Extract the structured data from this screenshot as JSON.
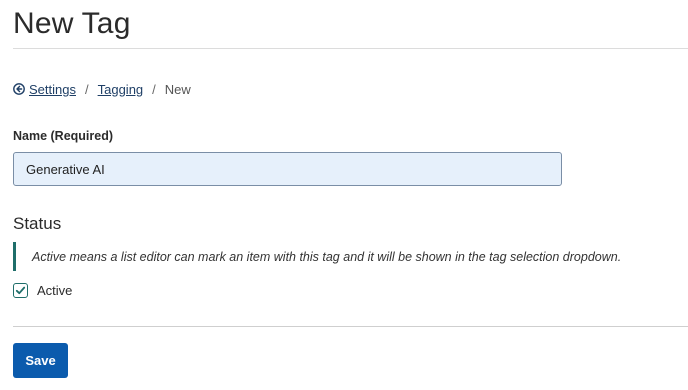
{
  "page": {
    "title": "New Tag"
  },
  "breadcrumb": {
    "back_icon": "circle-arrow-left-icon",
    "items": [
      {
        "label": "Settings",
        "link": true
      },
      {
        "label": "Tagging",
        "link": true
      },
      {
        "label": "New",
        "link": false
      }
    ],
    "separator": "/"
  },
  "form": {
    "name_label": "Name (Required)",
    "name_value": "Generative AI",
    "status_heading": "Status",
    "status_help": "Active means a list editor can mark an item with this tag and it will be shown in the tag selection dropdown.",
    "active_label": "Active",
    "active_checked": true,
    "save_label": "Save"
  },
  "colors": {
    "primary_button": "#0b5bad",
    "link": "#1f3f66",
    "accent_teal": "#1f6e6a",
    "input_background": "#e6f0fb"
  }
}
